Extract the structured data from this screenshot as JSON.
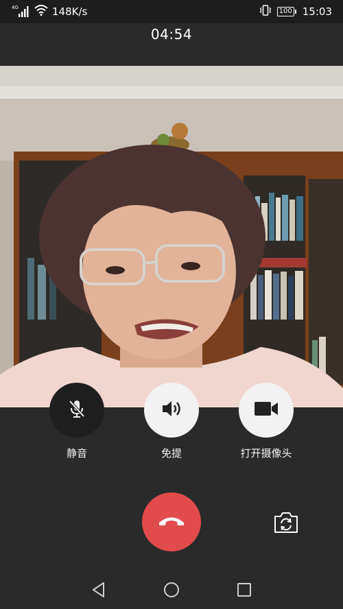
{
  "status_bar": {
    "network_type": "4G",
    "net_speed": "148K/s",
    "battery": "100",
    "time": "15:03"
  },
  "call": {
    "duration": "04:54"
  },
  "controls": {
    "mute_label": "静音",
    "speaker_label": "免提",
    "camera_label": "打开摄像头"
  },
  "colors": {
    "hangup": "#e24b4b",
    "background": "#2a2a2a",
    "button_light": "#f2f2f2",
    "button_dark": "#1e1e1e"
  },
  "icons": {
    "mute": "mic-off-icon",
    "speaker": "speaker-icon",
    "camera": "video-camera-icon",
    "hangup": "phone-hangup-icon",
    "switch_camera": "camera-switch-icon",
    "nav_back": "back-triangle-icon",
    "nav_home": "home-circle-icon",
    "nav_recents": "recents-square-icon"
  }
}
